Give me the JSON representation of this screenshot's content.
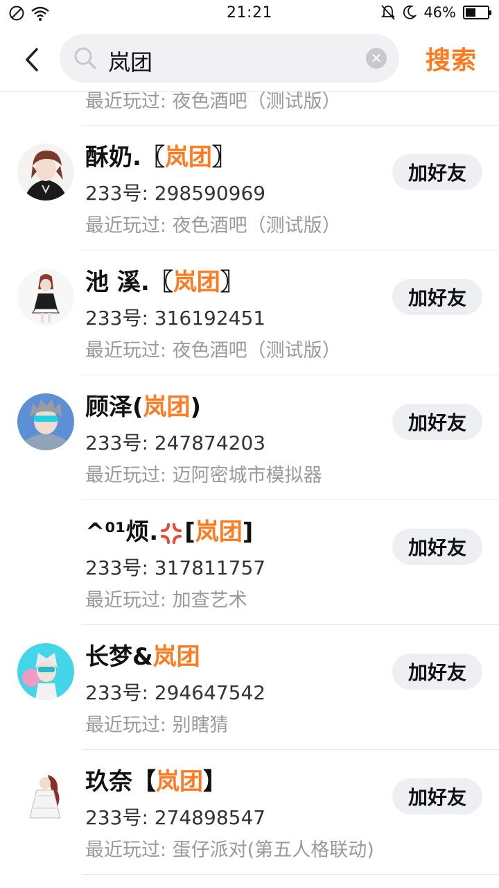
{
  "status_bar": {
    "time": "21:21",
    "battery_percent": "46%",
    "battery_level": 0.46
  },
  "header": {
    "search_query": "岚团",
    "search_button": "搜索"
  },
  "partial_row": {
    "recent_label": "最近玩过: 夜色酒吧（测试版）"
  },
  "results": [
    {
      "name_prefix": "酥奶.〖",
      "highlight": "岚团",
      "name_suffix": "〗",
      "uid": "233号: 298590969",
      "recent": "最近玩过: 夜色酒吧（测试版）",
      "add_label": "加好友"
    },
    {
      "name_prefix": "池 溪.〖",
      "highlight": "岚团",
      "name_suffix": "〗",
      "uid": "233号: 316192451",
      "recent": "最近玩过: 夜色酒吧（测试版）",
      "add_label": "加好友"
    },
    {
      "name_prefix": "顾泽(",
      "highlight": "岚团",
      "name_suffix": ")",
      "uid": "233号: 247874203",
      "recent": "最近玩过: 迈阿密城市模拟器",
      "add_label": "加好友"
    },
    {
      "name_prefix": "^⁰¹烦.",
      "name_mid": "[",
      "highlight": "岚团",
      "name_suffix": "]",
      "uid": "233号: 317811757",
      "recent": "最近玩过: 加查艺术",
      "add_label": "加好友"
    },
    {
      "name_prefix": "长梦&",
      "highlight": "岚团",
      "name_suffix": "",
      "uid": "233号: 294647542",
      "recent": "最近玩过: 别瞎猜",
      "add_label": "加好友"
    },
    {
      "name_prefix": "玖奈【",
      "highlight": "岚团",
      "name_suffix": "】",
      "uid": "233号: 274898547",
      "recent": "最近玩过: 蛋仔派对(第五人格联动)",
      "add_label": "加好友"
    }
  ],
  "colors": {
    "accent": "#ff7a1e",
    "button_bg": "#edeff3",
    "secondary_text": "#9a9a9a"
  }
}
